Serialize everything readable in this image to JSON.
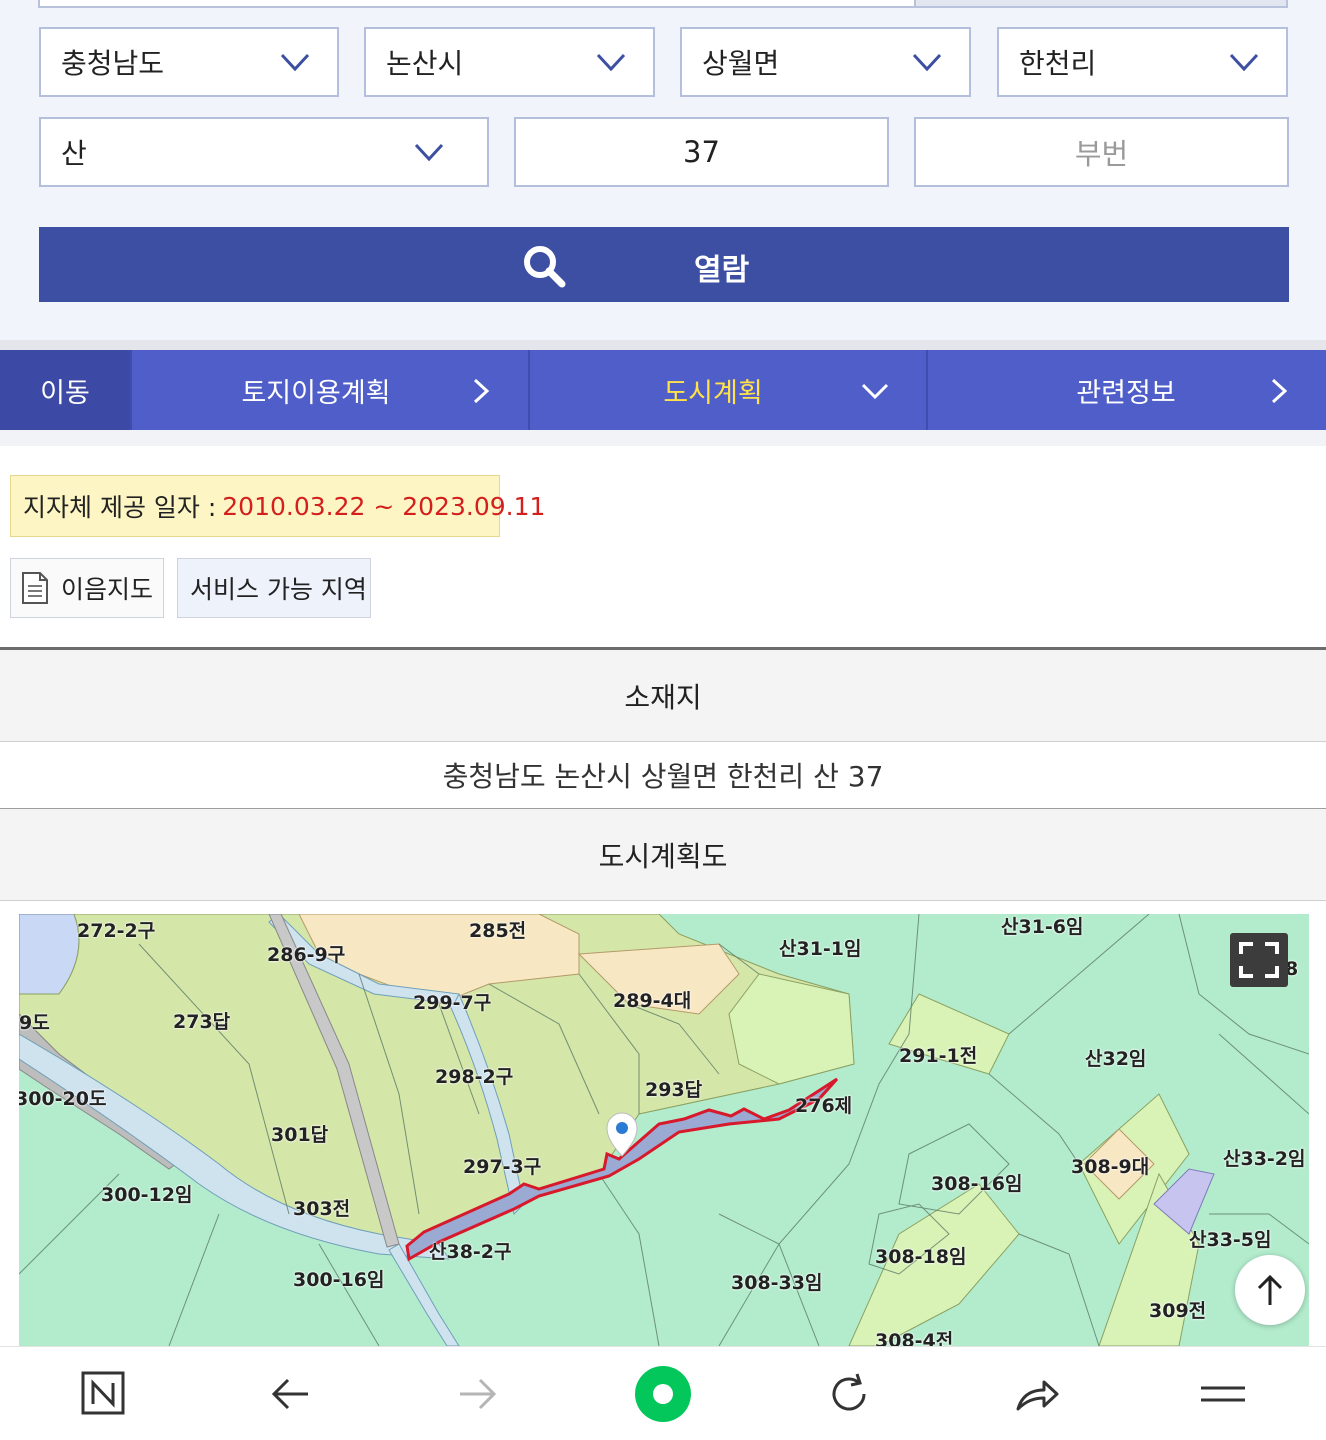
{
  "search": {
    "province": "충청남도",
    "city": "논산시",
    "town": "상월면",
    "village": "한천리",
    "land_type": "산",
    "main_number": "37",
    "sub_number_placeholder": "부번",
    "view_button": "열람"
  },
  "tabs": {
    "move": "이동",
    "items": [
      "토지이용계획",
      "도시계획",
      "관련정보"
    ]
  },
  "date_info": {
    "label": "지자체 제공 일자 :",
    "range": "2010.03.22 ~ 2023.09.11"
  },
  "links": {
    "map": "이음지도",
    "service_area": "서비스 가능 지역"
  },
  "table": {
    "location_header": "소재지",
    "location_value": "충청남도 논산시 상월면 한천리 산 37",
    "plan_header": "도시계획도"
  },
  "map_labels": [
    "272-2구",
    "285전",
    "286-9구",
    "산31-1임",
    "산31-6임",
    "299-7구",
    "289-4대",
    "273답",
    "291-1전",
    "산32임",
    "9도",
    "298-2구",
    "293답",
    "276제",
    "300-20도",
    "301답",
    "297-3구",
    "308-16임",
    "308-9대",
    "산33-2임",
    "300-12임",
    "303전",
    "산38-2구",
    "308-18임",
    "산33-5임",
    "300-16임",
    "308-33임",
    "309전",
    "308-4전",
    "8"
  ],
  "colors": {
    "primary": "#3d4fa3",
    "tab_bar": "#4f5ec9",
    "active_tab": "#ffe24a",
    "date_red": "#d3201e",
    "parcel_outline": "#d7192b",
    "nav_green": "#03c75a"
  },
  "icons": {
    "search_button": "search-icon",
    "expand": "expand-icon",
    "scroll_top": "arrow-up-icon"
  }
}
